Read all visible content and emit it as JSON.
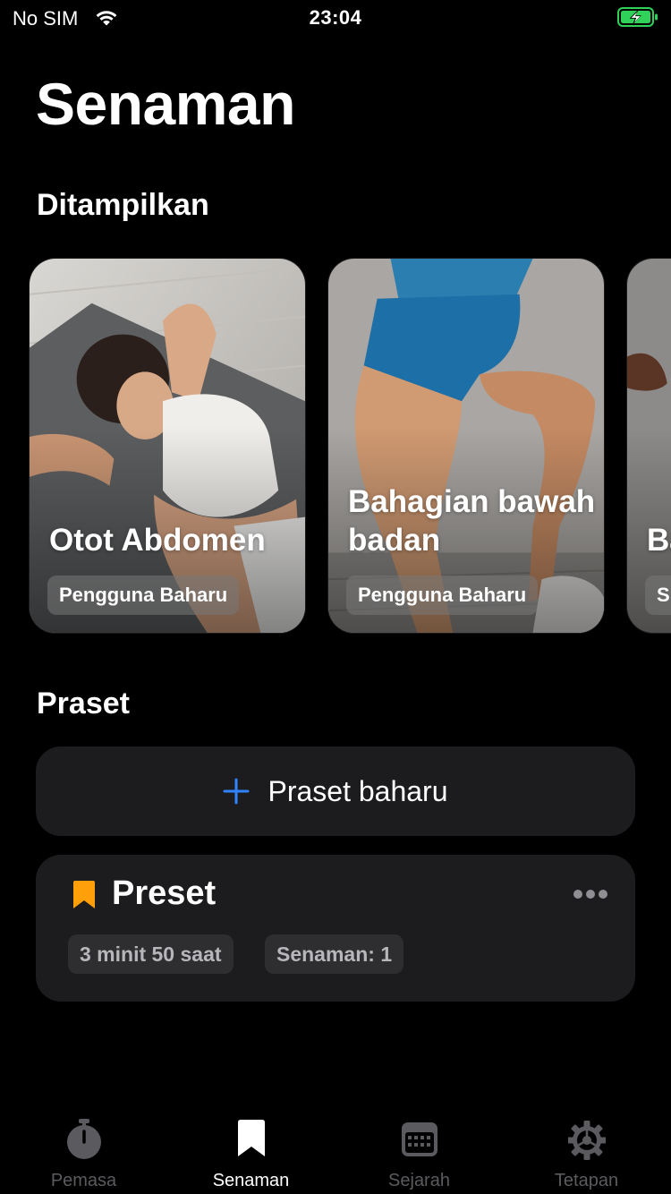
{
  "status_bar": {
    "carrier": "No SIM",
    "time": "23:04",
    "wifi_icon": "wifi-icon",
    "battery_icon": "battery-charging-icon",
    "battery_color": "#30d158"
  },
  "page": {
    "title": "Senaman"
  },
  "featured": {
    "heading": "Ditampilkan",
    "cards": [
      {
        "title": "Otot Abdomen",
        "badge": "Pengguna Baharu"
      },
      {
        "title": "Bahagian bawah badan",
        "badge": "Pengguna Baharu"
      },
      {
        "title": "Ba at",
        "badge": "S"
      }
    ]
  },
  "presets": {
    "heading": "Praset",
    "new_button_label": "Praset baharu",
    "plus_icon": "plus-icon",
    "accent_color": "#2f83ff",
    "items": [
      {
        "name": "Preset",
        "icon": "bookmark-icon",
        "icon_color": "#ff9f0a",
        "duration": "3 minit 50 saat",
        "workouts": "Senaman: 1",
        "more_icon": "more-icon"
      }
    ]
  },
  "tab_bar": {
    "active_index": 1,
    "tabs": [
      {
        "label": "Pemasa",
        "icon": "stopwatch-icon"
      },
      {
        "label": "Senaman",
        "icon": "bookmark-icon"
      },
      {
        "label": "Sejarah",
        "icon": "calendar-icon"
      },
      {
        "label": "Tetapan",
        "icon": "gear-icon"
      }
    ]
  }
}
